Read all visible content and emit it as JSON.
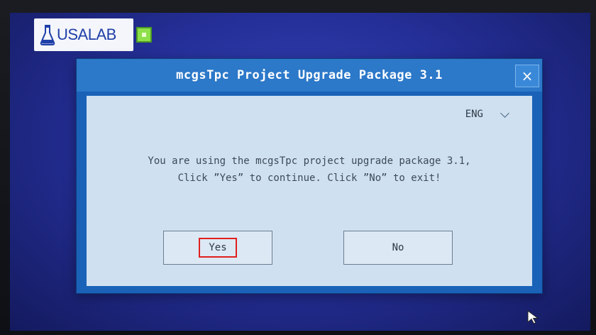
{
  "logo": {
    "text": "USALAB",
    "icon": "flask-icon"
  },
  "taskbar": {
    "icon": "green-app-icon",
    "color": "#8ee04a"
  },
  "dialog": {
    "title": "mcgsTpc Project Upgrade Package 3.1",
    "close_label": "×",
    "language": {
      "selected": "ENG"
    },
    "message_line1": "You are using the mcgsTpc project upgrade package 3.1,",
    "message_line2": "Click ”Yes” to continue. Click ”No” to exit!",
    "yes_label": "Yes",
    "no_label": "No"
  },
  "colors": {
    "dialog_blue": "#1a62b8",
    "titlebar": "#2c78c9",
    "panel": "#cfe0f0",
    "highlight": "#e0201d"
  }
}
